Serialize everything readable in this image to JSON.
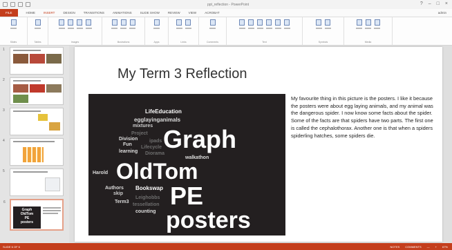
{
  "window": {
    "title": "ppt_reflection - PowerPoint",
    "controls": [
      "?",
      "–",
      "□",
      "×"
    ]
  },
  "tabs": [
    "FILE",
    "HOME",
    "INSERT",
    "DESIGN",
    "TRANSITIONS",
    "ANIMATIONS",
    "SLIDE SHOW",
    "REVIEW",
    "VIEW",
    "ACROBAT"
  ],
  "active_tab": "INSERT",
  "user": "admin",
  "ribbon_groups": [
    "Slides",
    "Tables",
    "Images",
    "Illustrations",
    "Apps",
    "Links",
    "Comments",
    "Text",
    "Symbols",
    "Media"
  ],
  "thumbnails": [
    "1",
    "2",
    "3",
    "4",
    "5",
    "6"
  ],
  "slide": {
    "title": "My Term 3 Reflection",
    "paragraph": "My favourite thing in this picture is the posters. I like it because the posters were about egg laying animals, and my animal was the dangerous spider. I now know some facts about the spider. Some of the facts are that spiders have two parts. The first one is called the cephalothorax. Another one is that when a spiders spiderling hatches, some spiders die.",
    "wordcloud": [
      {
        "text": "LifeEducation",
        "color": "#ffffff"
      },
      {
        "text": "egglayinganimals",
        "color": "#dddddd"
      },
      {
        "text": "mixtures",
        "color": "#cccccc"
      },
      {
        "text": "Project",
        "color": "#6d6d6d"
      },
      {
        "text": "Division",
        "color": "#dddddd"
      },
      {
        "text": "Fun",
        "color": "#dddddd"
      },
      {
        "text": "ipads",
        "color": "#6d6d6d"
      },
      {
        "text": "Lifecycle",
        "color": "#6d6d6d"
      },
      {
        "text": "learning",
        "color": "#dddddd"
      },
      {
        "text": "Diorama",
        "color": "#6d6d6d"
      },
      {
        "text": "Graph",
        "color": "#ffffff"
      },
      {
        "text": "walkathon",
        "color": "#dddddd"
      },
      {
        "text": "Harold",
        "color": "#dddddd"
      },
      {
        "text": "OldTom",
        "color": "#ffffff"
      },
      {
        "text": "Authors",
        "color": "#dddddd"
      },
      {
        "text": "Bookswap",
        "color": "#ffffff"
      },
      {
        "text": "skip",
        "color": "#cccccc"
      },
      {
        "text": "Leighobbs",
        "color": "#6d6d6d"
      },
      {
        "text": "Term3",
        "color": "#dddddd"
      },
      {
        "text": "tessellation",
        "color": "#6d6d6d"
      },
      {
        "text": "PE",
        "color": "#ffffff"
      },
      {
        "text": "counting",
        "color": "#dddddd"
      },
      {
        "text": "posters",
        "color": "#ffffff"
      }
    ]
  },
  "thumb6_words": [
    "Graph",
    "OldTom",
    "PE",
    "posters"
  ],
  "statusbar": {
    "left": "SLIDE 6 OF 6",
    "right": [
      "NOTES",
      "COMMENTS",
      "—",
      "+",
      "67%"
    ]
  },
  "colors": {
    "accent": "#c43e1c",
    "cloud_bg": "#231f20"
  }
}
